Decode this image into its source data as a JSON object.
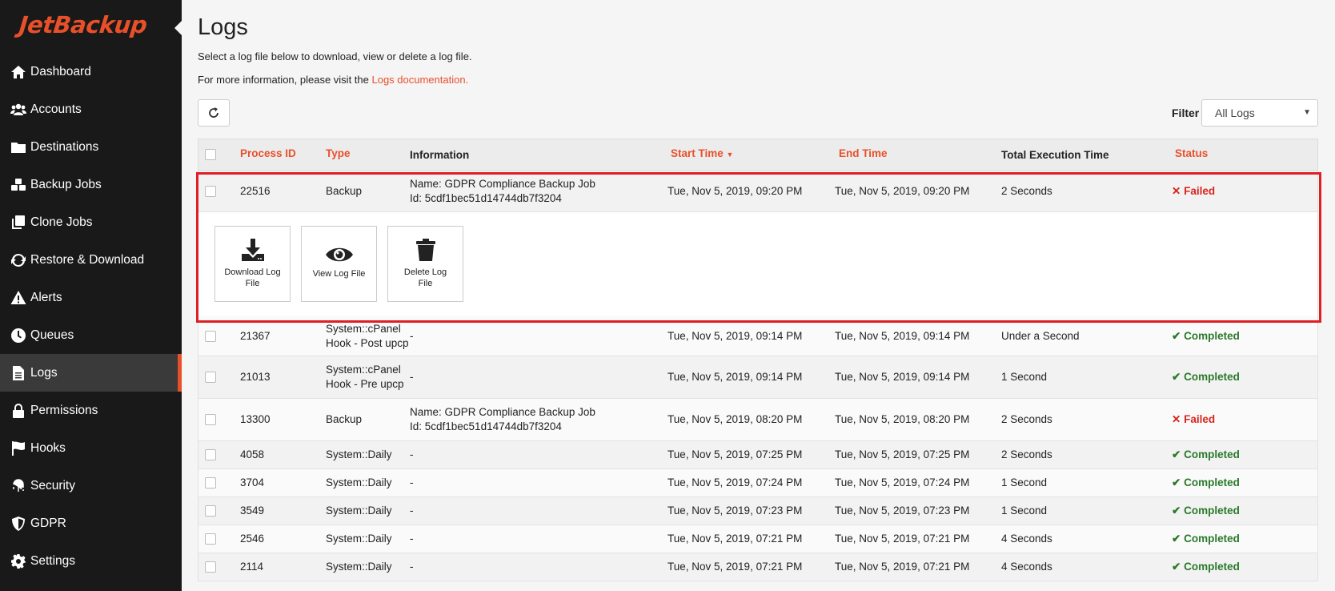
{
  "brand": {
    "logo_text": "JetBackup",
    "color": "#e8502a"
  },
  "sidebar": {
    "items": [
      {
        "label": "Dashboard",
        "icon": "home-icon"
      },
      {
        "label": "Accounts",
        "icon": "users-icon"
      },
      {
        "label": "Destinations",
        "icon": "folder-icon"
      },
      {
        "label": "Backup Jobs",
        "icon": "cubes-icon"
      },
      {
        "label": "Clone Jobs",
        "icon": "clone-icon"
      },
      {
        "label": "Restore & Download",
        "icon": "sync-icon"
      },
      {
        "label": "Alerts",
        "icon": "warning-icon"
      },
      {
        "label": "Queues",
        "icon": "clock-icon"
      },
      {
        "label": "Logs",
        "icon": "file-icon",
        "active": true
      },
      {
        "label": "Permissions",
        "icon": "lock-icon"
      },
      {
        "label": "Hooks",
        "icon": "flag-icon"
      },
      {
        "label": "Security",
        "icon": "fingerprint-icon"
      },
      {
        "label": "GDPR",
        "icon": "shield-icon"
      },
      {
        "label": "Settings",
        "icon": "gear-icon"
      }
    ]
  },
  "page": {
    "title": "Logs",
    "description": "Select a log file below to download, view or delete a log file.",
    "more_info_prefix": "For more information, please visit the ",
    "more_info_link": "Logs documentation.",
    "filter_label": "Filter",
    "filter_value": "All Logs"
  },
  "table": {
    "headers": {
      "process_id": "Process ID",
      "type": "Type",
      "information": "Information",
      "start_time": "Start Time",
      "end_time": "End Time",
      "total_execution_time": "Total Execution Time",
      "status": "Status"
    },
    "expanded_row": {
      "process_id": "22516",
      "type": "Backup",
      "info_line1": "Name: GDPR Compliance Backup Job",
      "info_line2": "Id: 5cdf1bec51d14744db7f3204",
      "start_time": "Tue, Nov 5, 2019, 09:20 PM",
      "end_time": "Tue, Nov 5, 2019, 09:20 PM",
      "total": "2 Seconds",
      "status": "Failed"
    },
    "actions": {
      "download_line1": "Download Log",
      "download_line2": "File",
      "view": "View Log File",
      "delete_line1": "Delete Log",
      "delete_line2": "File"
    },
    "rows": [
      {
        "process_id": "21367",
        "type_line1": "System::cPanel",
        "type_line2": "Hook - Post upcp",
        "info_line1": "-",
        "info_line2": "",
        "start_time": "Tue, Nov 5, 2019, 09:14 PM",
        "end_time": "Tue, Nov 5, 2019, 09:14 PM",
        "total": "Under a Second",
        "status": "Completed"
      },
      {
        "process_id": "21013",
        "type_line1": "System::cPanel",
        "type_line2": "Hook - Pre upcp",
        "info_line1": "-",
        "info_line2": "",
        "start_time": "Tue, Nov 5, 2019, 09:14 PM",
        "end_time": "Tue, Nov 5, 2019, 09:14 PM",
        "total": "1 Second",
        "status": "Completed"
      },
      {
        "process_id": "13300",
        "type_line1": "Backup",
        "type_line2": "",
        "info_line1": "Name: GDPR Compliance Backup Job",
        "info_line2": "Id: 5cdf1bec51d14744db7f3204",
        "start_time": "Tue, Nov 5, 2019, 08:20 PM",
        "end_time": "Tue, Nov 5, 2019, 08:20 PM",
        "total": "2 Seconds",
        "status": "Failed"
      },
      {
        "process_id": "4058",
        "type_line1": "System::Daily",
        "type_line2": "",
        "info_line1": "-",
        "info_line2": "",
        "start_time": "Tue, Nov 5, 2019, 07:25 PM",
        "end_time": "Tue, Nov 5, 2019, 07:25 PM",
        "total": "2 Seconds",
        "status": "Completed"
      },
      {
        "process_id": "3704",
        "type_line1": "System::Daily",
        "type_line2": "",
        "info_line1": "-",
        "info_line2": "",
        "start_time": "Tue, Nov 5, 2019, 07:24 PM",
        "end_time": "Tue, Nov 5, 2019, 07:24 PM",
        "total": "1 Second",
        "status": "Completed"
      },
      {
        "process_id": "3549",
        "type_line1": "System::Daily",
        "type_line2": "",
        "info_line1": "-",
        "info_line2": "",
        "start_time": "Tue, Nov 5, 2019, 07:23 PM",
        "end_time": "Tue, Nov 5, 2019, 07:23 PM",
        "total": "1 Second",
        "status": "Completed"
      },
      {
        "process_id": "2546",
        "type_line1": "System::Daily",
        "type_line2": "",
        "info_line1": "-",
        "info_line2": "",
        "start_time": "Tue, Nov 5, 2019, 07:21 PM",
        "end_time": "Tue, Nov 5, 2019, 07:21 PM",
        "total": "4 Seconds",
        "status": "Completed"
      },
      {
        "process_id": "2114",
        "type_line1": "System::Daily",
        "type_line2": "",
        "info_line1": "-",
        "info_line2": "",
        "start_time": "Tue, Nov 5, 2019, 07:21 PM",
        "end_time": "Tue, Nov 5, 2019, 07:21 PM",
        "total": "4 Seconds",
        "status": "Completed"
      }
    ]
  },
  "colors": {
    "accent": "#e8502a",
    "failed": "#d9231d",
    "completed": "#2a7a2a",
    "highlight": "#e01e25"
  }
}
